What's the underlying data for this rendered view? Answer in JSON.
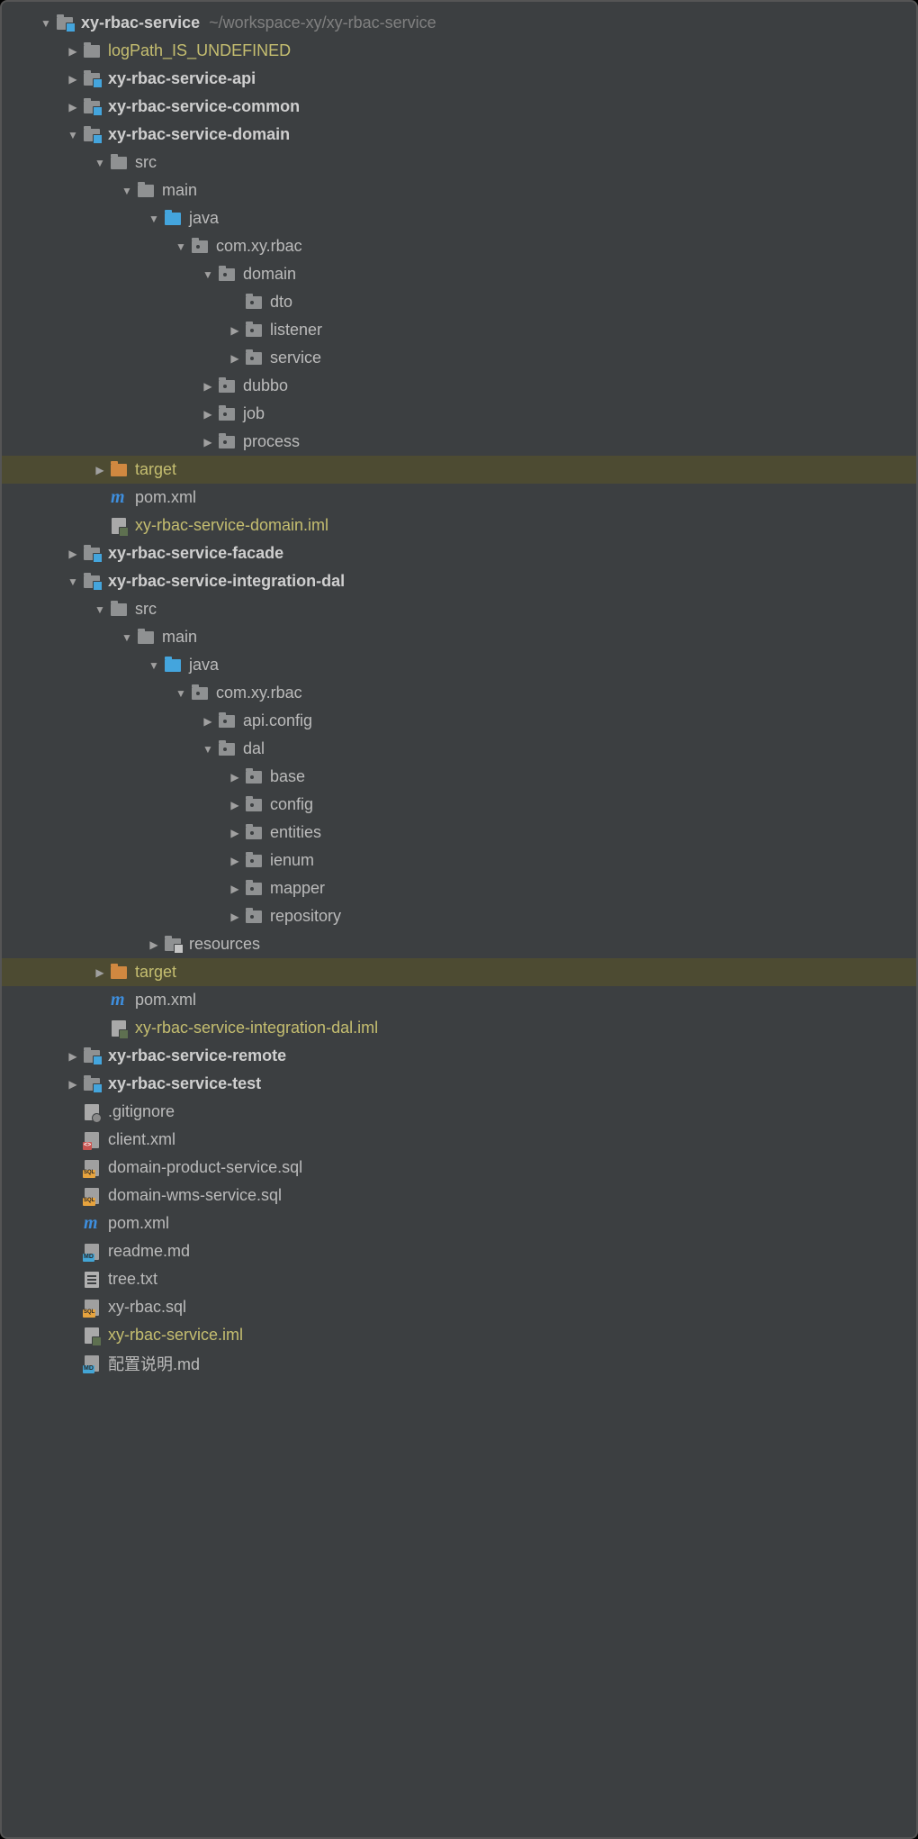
{
  "rootPath": "~/workspace-xy/xy-rbac-service",
  "indentStart": 40,
  "indentStep": 30,
  "nodes": [
    {
      "depth": 0,
      "arrow": "expanded",
      "icon": "module-folder",
      "label": "xy-rbac-service",
      "bold": true,
      "path": "~/workspace-xy/xy-rbac-service"
    },
    {
      "depth": 1,
      "arrow": "collapsed",
      "icon": "folder-grey",
      "label": "logPath_IS_UNDEFINED",
      "color": "yellow"
    },
    {
      "depth": 1,
      "arrow": "collapsed",
      "icon": "module-folder",
      "label": "xy-rbac-service-api",
      "bold": true
    },
    {
      "depth": 1,
      "arrow": "collapsed",
      "icon": "module-folder",
      "label": "xy-rbac-service-common",
      "bold": true
    },
    {
      "depth": 1,
      "arrow": "expanded",
      "icon": "module-folder",
      "label": "xy-rbac-service-domain",
      "bold": true
    },
    {
      "depth": 2,
      "arrow": "expanded",
      "icon": "folder-grey",
      "label": "src"
    },
    {
      "depth": 3,
      "arrow": "expanded",
      "icon": "folder-grey",
      "label": "main"
    },
    {
      "depth": 4,
      "arrow": "expanded",
      "icon": "folder-blue",
      "label": "java"
    },
    {
      "depth": 5,
      "arrow": "expanded",
      "icon": "package",
      "label": "com.xy.rbac"
    },
    {
      "depth": 6,
      "arrow": "expanded",
      "icon": "package",
      "label": "domain"
    },
    {
      "depth": 7,
      "arrow": "none",
      "icon": "package",
      "label": "dto"
    },
    {
      "depth": 7,
      "arrow": "collapsed",
      "icon": "package",
      "label": "listener"
    },
    {
      "depth": 7,
      "arrow": "collapsed",
      "icon": "package",
      "label": "service"
    },
    {
      "depth": 6,
      "arrow": "collapsed",
      "icon": "package",
      "label": "dubbo"
    },
    {
      "depth": 6,
      "arrow": "collapsed",
      "icon": "package",
      "label": "job"
    },
    {
      "depth": 6,
      "arrow": "collapsed",
      "icon": "package",
      "label": "process"
    },
    {
      "depth": 2,
      "arrow": "collapsed",
      "icon": "folder-orange",
      "label": "target",
      "color": "yellow",
      "highlight": true
    },
    {
      "depth": 2,
      "arrow": "none",
      "icon": "maven",
      "label": "pom.xml"
    },
    {
      "depth": 2,
      "arrow": "none",
      "icon": "iml",
      "label": "xy-rbac-service-domain.iml",
      "color": "yellow"
    },
    {
      "depth": 1,
      "arrow": "collapsed",
      "icon": "module-folder",
      "label": "xy-rbac-service-facade",
      "bold": true
    },
    {
      "depth": 1,
      "arrow": "expanded",
      "icon": "module-folder",
      "label": "xy-rbac-service-integration-dal",
      "bold": true
    },
    {
      "depth": 2,
      "arrow": "expanded",
      "icon": "folder-grey",
      "label": "src"
    },
    {
      "depth": 3,
      "arrow": "expanded",
      "icon": "folder-grey",
      "label": "main"
    },
    {
      "depth": 4,
      "arrow": "expanded",
      "icon": "folder-blue",
      "label": "java"
    },
    {
      "depth": 5,
      "arrow": "expanded",
      "icon": "package",
      "label": "com.xy.rbac"
    },
    {
      "depth": 6,
      "arrow": "collapsed",
      "icon": "package",
      "label": "api.config"
    },
    {
      "depth": 6,
      "arrow": "expanded",
      "icon": "package",
      "label": "dal"
    },
    {
      "depth": 7,
      "arrow": "collapsed",
      "icon": "package",
      "label": "base"
    },
    {
      "depth": 7,
      "arrow": "collapsed",
      "icon": "package",
      "label": "config"
    },
    {
      "depth": 7,
      "arrow": "collapsed",
      "icon": "package",
      "label": "entities"
    },
    {
      "depth": 7,
      "arrow": "collapsed",
      "icon": "package",
      "label": "ienum"
    },
    {
      "depth": 7,
      "arrow": "collapsed",
      "icon": "package",
      "label": "mapper"
    },
    {
      "depth": 7,
      "arrow": "collapsed",
      "icon": "package",
      "label": "repository"
    },
    {
      "depth": 4,
      "arrow": "collapsed",
      "icon": "resources",
      "label": "resources"
    },
    {
      "depth": 2,
      "arrow": "collapsed",
      "icon": "folder-orange",
      "label": "target",
      "color": "yellow",
      "highlight": true
    },
    {
      "depth": 2,
      "arrow": "none",
      "icon": "maven",
      "label": "pom.xml"
    },
    {
      "depth": 2,
      "arrow": "none",
      "icon": "iml",
      "label": "xy-rbac-service-integration-dal.iml",
      "color": "yellow"
    },
    {
      "depth": 1,
      "arrow": "collapsed",
      "icon": "module-folder",
      "label": "xy-rbac-service-remote",
      "bold": true
    },
    {
      "depth": 1,
      "arrow": "collapsed",
      "icon": "module-folder",
      "label": "xy-rbac-service-test",
      "bold": true
    },
    {
      "depth": 1,
      "arrow": "none",
      "icon": "gitignore",
      "label": ".gitignore"
    },
    {
      "depth": 1,
      "arrow": "none",
      "icon": "xml",
      "label": "client.xml"
    },
    {
      "depth": 1,
      "arrow": "none",
      "icon": "sql",
      "label": "domain-product-service.sql"
    },
    {
      "depth": 1,
      "arrow": "none",
      "icon": "sql",
      "label": "domain-wms-service.sql"
    },
    {
      "depth": 1,
      "arrow": "none",
      "icon": "maven",
      "label": "pom.xml"
    },
    {
      "depth": 1,
      "arrow": "none",
      "icon": "md",
      "label": "readme.md"
    },
    {
      "depth": 1,
      "arrow": "none",
      "icon": "text",
      "label": "tree.txt"
    },
    {
      "depth": 1,
      "arrow": "none",
      "icon": "sql",
      "label": "xy-rbac.sql"
    },
    {
      "depth": 1,
      "arrow": "none",
      "icon": "iml",
      "label": "xy-rbac-service.iml",
      "color": "yellow"
    },
    {
      "depth": 1,
      "arrow": "none",
      "icon": "md",
      "label": "配置说明.md"
    }
  ]
}
